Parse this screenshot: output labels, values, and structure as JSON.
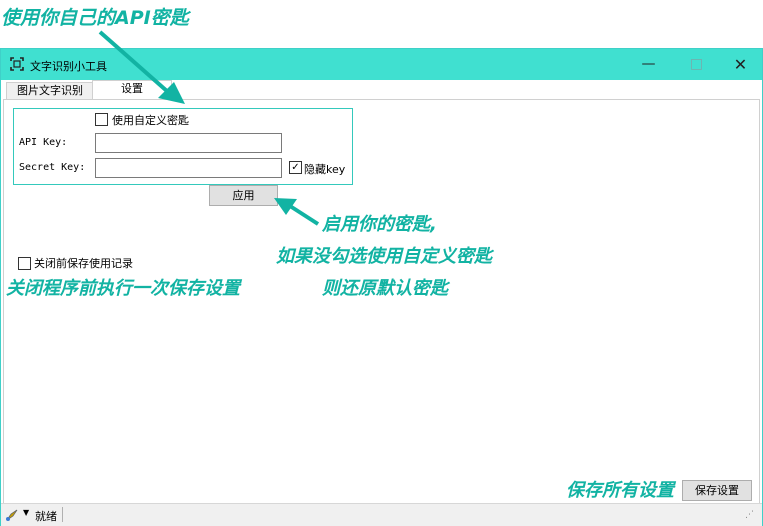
{
  "window": {
    "title": "文字识别小工具",
    "controls": {
      "minimize": "—",
      "maximize": "□",
      "close": "✕"
    }
  },
  "tabs": [
    {
      "label": "图片文字识别",
      "active": false
    },
    {
      "label": "设置",
      "active": true
    }
  ],
  "settings": {
    "use_custom_key_label": "使用自定义密匙",
    "use_custom_key_checked": false,
    "api_key_label": "API Key:",
    "api_key_value": "",
    "secret_key_label": "Secret Key:",
    "secret_key_value": "",
    "hide_key_label": "隐藏key",
    "hide_key_checked": true,
    "apply_button": "应用",
    "save_on_close_label": "关闭前保存使用记录",
    "save_on_close_checked": false,
    "save_all_button": "保存设置"
  },
  "status_bar": {
    "status_text": "就绪"
  },
  "annotations": {
    "top": "使用你自己的API密匙",
    "middle_line1": "启用你的密匙,",
    "middle_line2": "如果没勾选使用自定义密匙",
    "middle_line3": "则还原默认密匙",
    "left": "关闭程序前执行一次保存设置",
    "bottom": "保存所有设置"
  },
  "colors": {
    "titlebar": "#40e0d0",
    "accent_border": "#34c9bc",
    "annotation": "#12b3a3"
  }
}
